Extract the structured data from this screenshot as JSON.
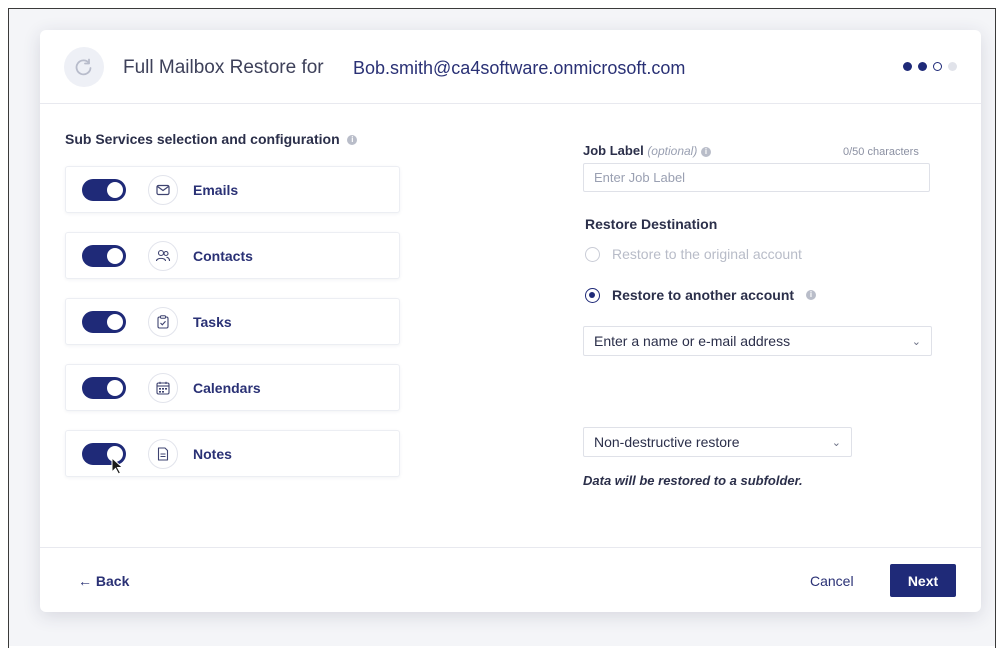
{
  "header": {
    "title_prefix": "Full Mailbox Restore for",
    "account_email": "Bob.smith@ca4software.onmicrosoft.com",
    "steps": [
      "done",
      "done",
      "current",
      "todo"
    ]
  },
  "sub_services": {
    "title": "Sub Services selection and configuration",
    "items": [
      {
        "label": "Emails",
        "icon": "mail-icon",
        "enabled": true
      },
      {
        "label": "Contacts",
        "icon": "contacts-icon",
        "enabled": true
      },
      {
        "label": "Tasks",
        "icon": "tasks-icon",
        "enabled": true
      },
      {
        "label": "Calendars",
        "icon": "calendar-icon",
        "enabled": true
      },
      {
        "label": "Notes",
        "icon": "notes-icon",
        "enabled": true
      }
    ]
  },
  "job_label": {
    "label": "Job Label",
    "optional": "(optional)",
    "char_count": "0/50 characters",
    "placeholder": "Enter Job Label",
    "value": ""
  },
  "restore_destination": {
    "title": "Restore Destination",
    "option_original": "Restore to the original account",
    "option_another": "Restore to another account",
    "selected": "another",
    "account_select": "Enter a name or e-mail address"
  },
  "restore_mode": {
    "selected": "Non-destructive restore",
    "note": "Data will be restored to a subfolder."
  },
  "footer": {
    "back": "← Back",
    "cancel": "Cancel",
    "next": "Next"
  },
  "colors": {
    "primary": "#1f2a78",
    "text": "#2b2f4a",
    "muted": "#9aa0b2"
  }
}
